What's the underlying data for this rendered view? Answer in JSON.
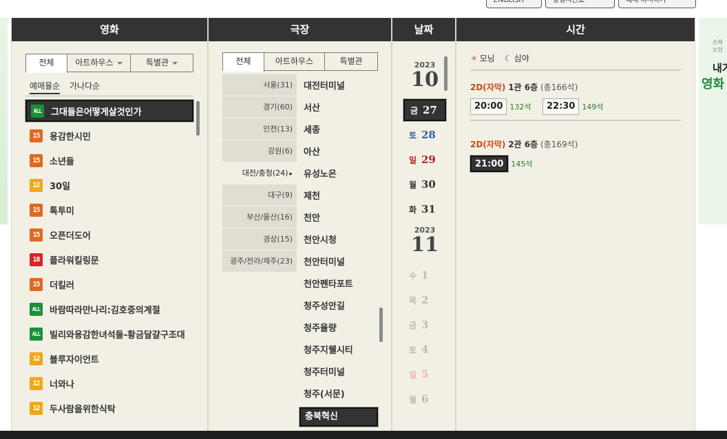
{
  "top_buttons": [
    "ENGLISH",
    "상영시간표",
    "예매 다시하기"
  ],
  "banner_right": {
    "small": "손해보험",
    "line1": "내가",
    "line2": "영화 예"
  },
  "movie_panel": {
    "title": "영화",
    "tabs": [
      "전체",
      "아트하우스",
      "특별관"
    ],
    "sort": [
      "예매율순",
      "가나다순"
    ],
    "movies": [
      {
        "rating": "ALL",
        "title": "그대들은어떻게살것인가",
        "selected": true
      },
      {
        "rating": "15",
        "title": "용감한시민"
      },
      {
        "rating": "15",
        "title": "소년들"
      },
      {
        "rating": "12",
        "title": "30일"
      },
      {
        "rating": "15",
        "title": "톡투미"
      },
      {
        "rating": "15",
        "title": "오픈더도어"
      },
      {
        "rating": "18",
        "title": "플라워킬링문"
      },
      {
        "rating": "15",
        "title": "더킬러"
      },
      {
        "rating": "ALL",
        "title": "바람따라만나리:김호중의계절"
      },
      {
        "rating": "ALL",
        "title": "빌리와용감한녀석들-황금달걀구조대"
      },
      {
        "rating": "12",
        "title": "블루자이언트"
      },
      {
        "rating": "12",
        "title": "너와나"
      },
      {
        "rating": "12",
        "title": "두사람을위한식탁"
      }
    ]
  },
  "theater_panel": {
    "title": "극장",
    "tabs": [
      "전체",
      "아트하우스",
      "특별관"
    ],
    "regions": [
      "서울(31)",
      "경기(60)",
      "인천(13)",
      "강원(6)",
      "대전/충청(24)",
      "대구(9)",
      "부산/울산(16)",
      "경상(15)",
      "광주/전라/제주(23)"
    ],
    "selected_region": 4,
    "theaters": [
      "대전터미널",
      "서산",
      "세종",
      "아산",
      "유성노은",
      "제천",
      "천안",
      "천안시청",
      "천안터미널",
      "천안펜타포트",
      "청주성안길",
      "청주율량",
      "청주지웰시티",
      "청주터미널",
      "청주(서문)",
      "충북혁신"
    ],
    "selected_theater": 15
  },
  "date_panel": {
    "title": "날짜",
    "groups": [
      {
        "year": "2023",
        "month": "10",
        "days": [
          {
            "wd": "금",
            "d": "27",
            "type": "sel"
          },
          {
            "wd": "토",
            "d": "28",
            "type": "sat"
          },
          {
            "wd": "일",
            "d": "29",
            "type": "sun"
          },
          {
            "wd": "월",
            "d": "30",
            "type": ""
          },
          {
            "wd": "화",
            "d": "31",
            "type": ""
          }
        ]
      },
      {
        "year": "2023",
        "month": "11",
        "days": [
          {
            "wd": "수",
            "d": "1",
            "type": "dis"
          },
          {
            "wd": "목",
            "d": "2",
            "type": "dis"
          },
          {
            "wd": "금",
            "d": "3",
            "type": "dis"
          },
          {
            "wd": "토",
            "d": "4",
            "type": "dis"
          },
          {
            "wd": "일",
            "d": "5",
            "type": "dis sun"
          },
          {
            "wd": "월",
            "d": "6",
            "type": "dis"
          }
        ]
      }
    ]
  },
  "time_panel": {
    "title": "시간",
    "legend": {
      "morning": "모닝",
      "night": "심야"
    },
    "halls": [
      {
        "format": "2D(자막)",
        "name": "1관 6층",
        "capacity": "(총166석)",
        "slots": [
          {
            "time": "20:00",
            "seats": "132석",
            "selected": false
          },
          {
            "time": "22:30",
            "seats": "149석",
            "selected": false
          }
        ]
      },
      {
        "format": "2D(자막)",
        "name": "2관 6층",
        "capacity": "(총169석)",
        "slots": [
          {
            "time": "21:00",
            "seats": "145석",
            "selected": true
          }
        ]
      }
    ]
  },
  "colors": {
    "header": "#333333",
    "panel": "#f2f0e5",
    "accent": "#c44a14",
    "seats": "#2b7a2b"
  }
}
